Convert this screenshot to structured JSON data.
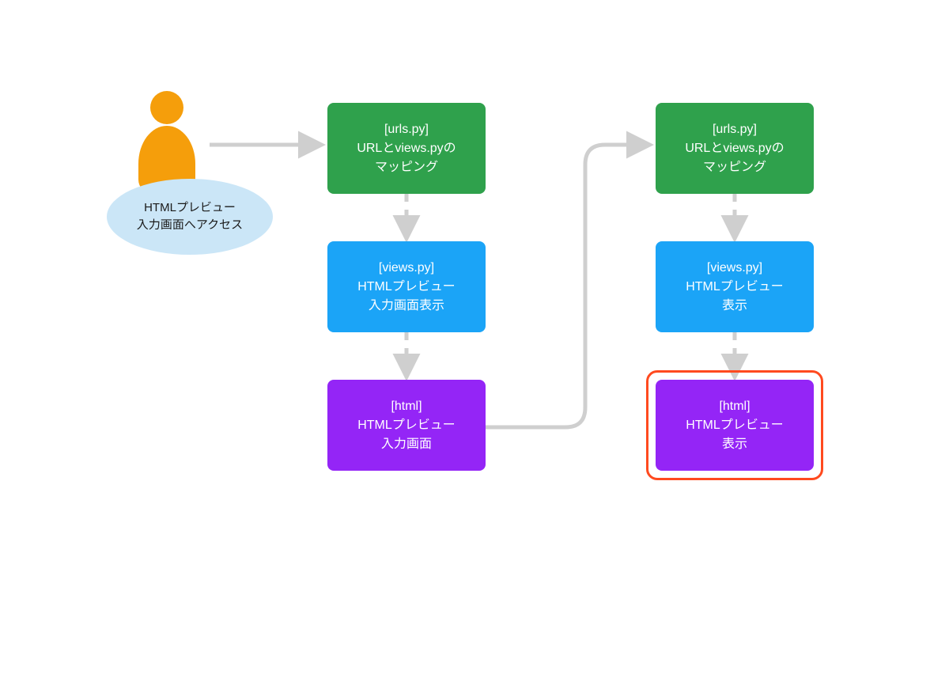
{
  "colors": {
    "green": "#2fa14c",
    "blue": "#1ba4f7",
    "purple": "#9425f6",
    "orange": "#f59e0b",
    "lightblue": "#cbe6f7",
    "arrow": "#cfcfcf",
    "highlight": "#ff4a1f"
  },
  "actor": {
    "name": "user"
  },
  "annotation": {
    "line1": "HTMLプレビュー",
    "line2": "入力画面へアクセス"
  },
  "left_column": {
    "urls": {
      "line1": "[urls.py]",
      "line2": "URLとviews.pyの",
      "line3": "マッピング"
    },
    "views": {
      "line1": "[views.py]",
      "line2": "HTMLプレビュー",
      "line3": "入力画面表示"
    },
    "html": {
      "line1": "[html]",
      "line2": "HTMLプレビュー",
      "line3": "入力画面"
    }
  },
  "right_column": {
    "urls": {
      "line1": "[urls.py]",
      "line2": "URLとviews.pyの",
      "line3": "マッピング"
    },
    "views": {
      "line1": "[views.py]",
      "line2": "HTMLプレビュー",
      "line3": "表示"
    },
    "html": {
      "line1": "[html]",
      "line2": "HTMLプレビュー",
      "line3": "表示"
    }
  }
}
